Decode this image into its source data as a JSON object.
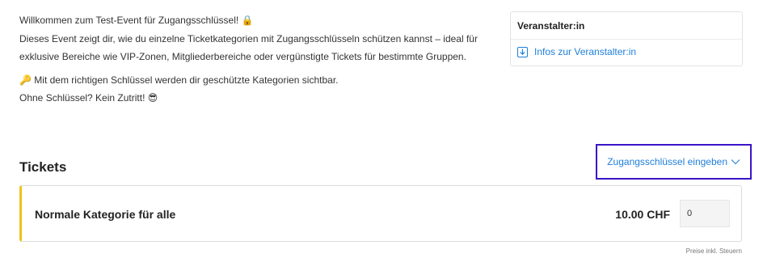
{
  "description": {
    "line1": "Willkommen zum Test-Event für Zugangsschlüssel!",
    "line1_emoji": "🔒",
    "line2": "Dieses Event zeigt dir, wie du einzelne Ticketkategorien mit Zugangsschlüsseln schützen kannst – ideal für",
    "line3": "exklusive Bereiche wie VIP-Zonen, Mitgliederbereiche oder vergünstigte Tickets für bestimmte Gruppen.",
    "line4_emoji": "🔑",
    "line4": "Mit dem richtigen Schlüssel werden dir geschützte Kategorien sichtbar.",
    "line5": "Ohne Schlüssel? Kein Zutritt!",
    "line5_emoji": "😎"
  },
  "organizer": {
    "title": "Veranstalter:in",
    "link_label": "Infos zur Veranstalter:in",
    "link_icon": "download-icon"
  },
  "tickets": {
    "heading": "Tickets",
    "access_key_label": "Zugangsschlüssel eingeben",
    "access_key_icon": "chevron-down-icon",
    "categories": [
      {
        "name": "Normale Kategorie für alle",
        "price": "10.00 CHF",
        "quantity": "0"
      }
    ],
    "tax_note": "Preise inkl. Steuern"
  },
  "colors": {
    "accent": "#1f7fd9",
    "highlight_border": "#3a14c8",
    "category_stripe": "#f2c11b"
  }
}
